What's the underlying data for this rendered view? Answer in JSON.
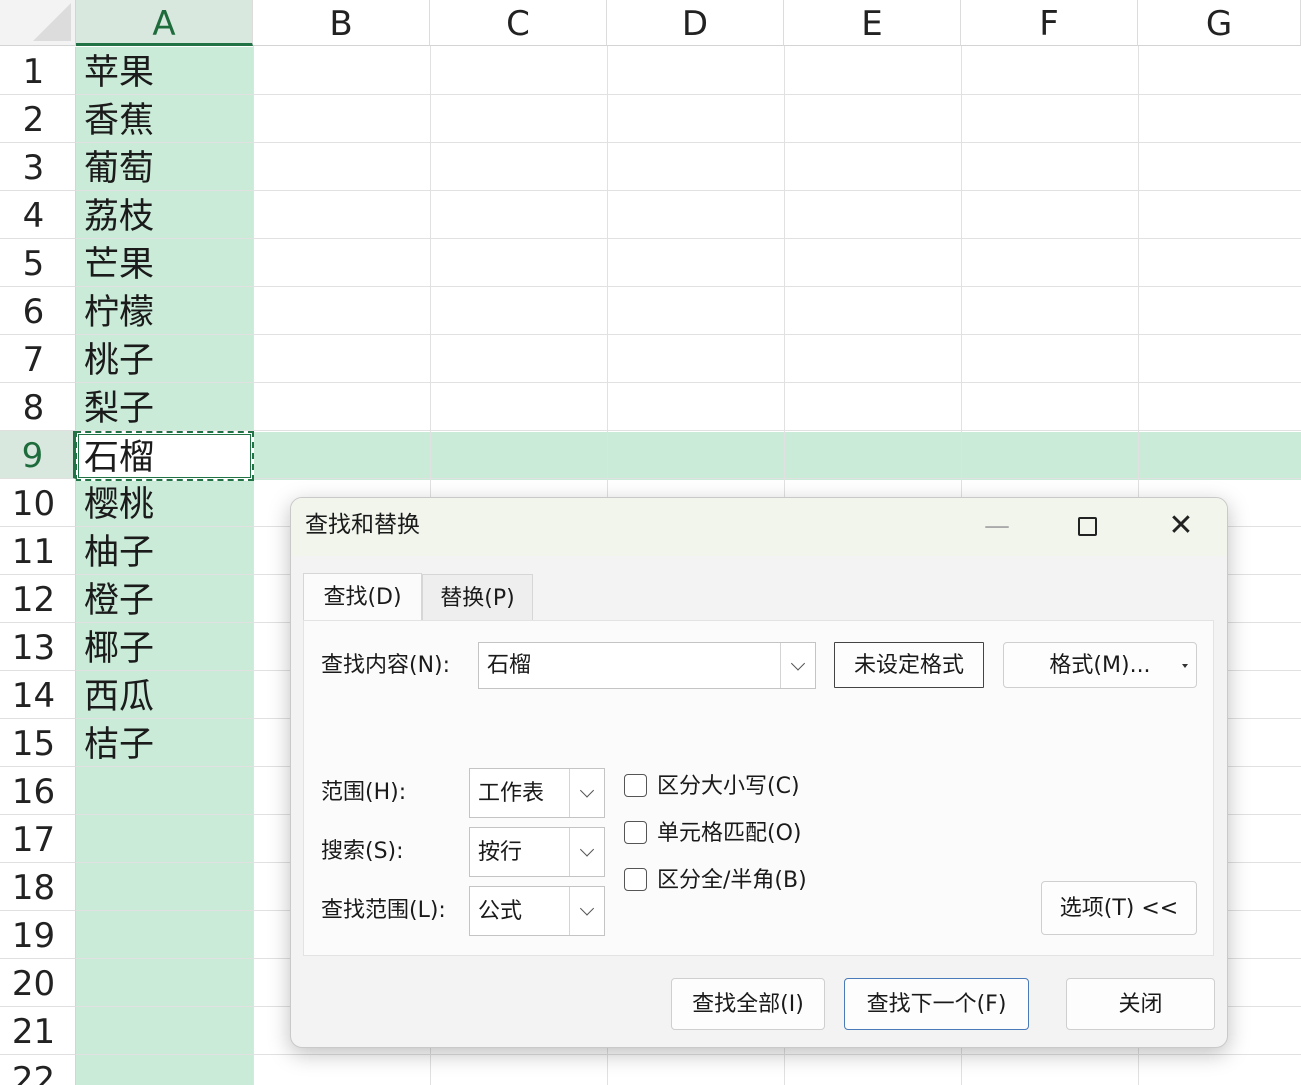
{
  "sheet": {
    "columns": [
      "A",
      "B",
      "C",
      "D",
      "E",
      "F",
      "G"
    ],
    "rows": [
      "1",
      "2",
      "3",
      "4",
      "5",
      "6",
      "7",
      "8",
      "9",
      "10",
      "11",
      "12",
      "13",
      "14",
      "15",
      "16",
      "17",
      "18",
      "19",
      "20",
      "21",
      "22"
    ],
    "cells_A": [
      "苹果",
      "香蕉",
      "葡萄",
      "荔枝",
      "芒果",
      "柠檬",
      "桃子",
      "梨子",
      "石榴",
      "樱桃",
      "柚子",
      "橙子",
      "椰子",
      "西瓜",
      "桔子"
    ],
    "selected_column": "A",
    "selected_row": "9",
    "accent_color": "#217346",
    "selection_fill": "#c9ebd8"
  },
  "dialog": {
    "title": "查找和替换",
    "minimize_icon": "—",
    "maximize_icon": "☐",
    "close_icon": "✕",
    "tabs": [
      {
        "label": "查找(D)",
        "active": true
      },
      {
        "label": "替换(P)",
        "active": false
      }
    ],
    "find_label": "查找内容(N):",
    "find_value": "石榴",
    "no_format_label": "未设定格式",
    "format_button": "格式(M)...",
    "scope_label": "范围(H):",
    "scope_value": "工作表",
    "search_label": "搜索(S):",
    "search_value": "按行",
    "lookin_label": "查找范围(L):",
    "lookin_value": "公式",
    "checkboxes": [
      {
        "label": "区分大小写(C)",
        "checked": false
      },
      {
        "label": "单元格匹配(O)",
        "checked": false
      },
      {
        "label": "区分全/半角(B)",
        "checked": false
      }
    ],
    "options_button": "选项(T) <<",
    "find_all_button": "查找全部(I)",
    "find_next_button": "查找下一个(F)",
    "close_button": "关闭"
  }
}
